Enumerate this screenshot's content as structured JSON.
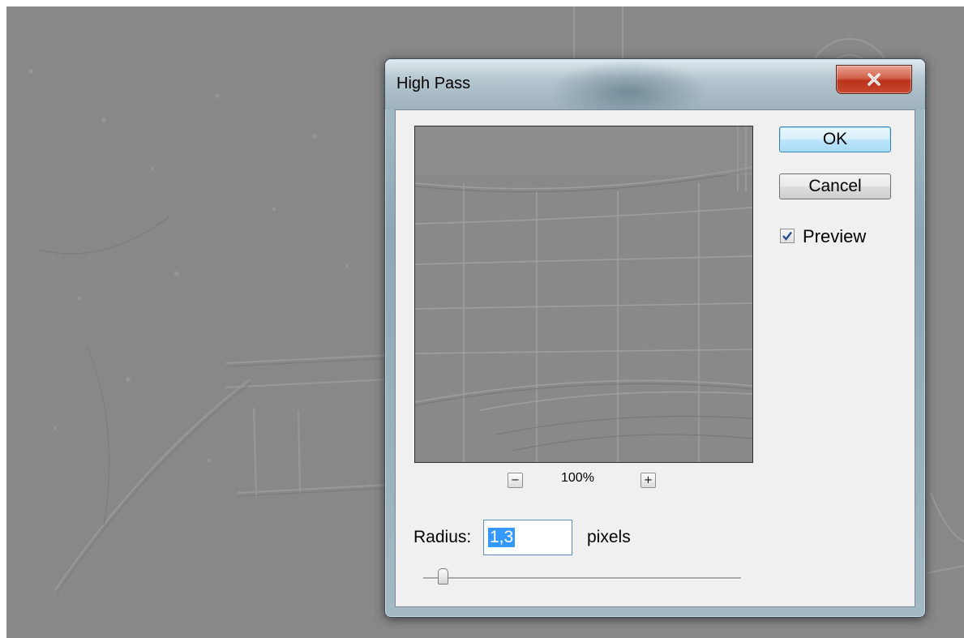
{
  "dialog": {
    "title": "High Pass",
    "close_icon": "close-x-icon"
  },
  "preview": {
    "zoom_out_label": "−",
    "zoom_in_label": "+",
    "zoom_value": "100%"
  },
  "buttons": {
    "ok": "OK",
    "cancel": "Cancel"
  },
  "preview_toggle": {
    "label": "Preview",
    "checked": true
  },
  "radius": {
    "label": "Radius:",
    "value": "1,3",
    "unit": "pixels",
    "slider_fraction": 0.06
  },
  "colors": {
    "default_button_border": "#3c7fb1",
    "close_button": "#c9492f",
    "selection": "#3399ff"
  }
}
